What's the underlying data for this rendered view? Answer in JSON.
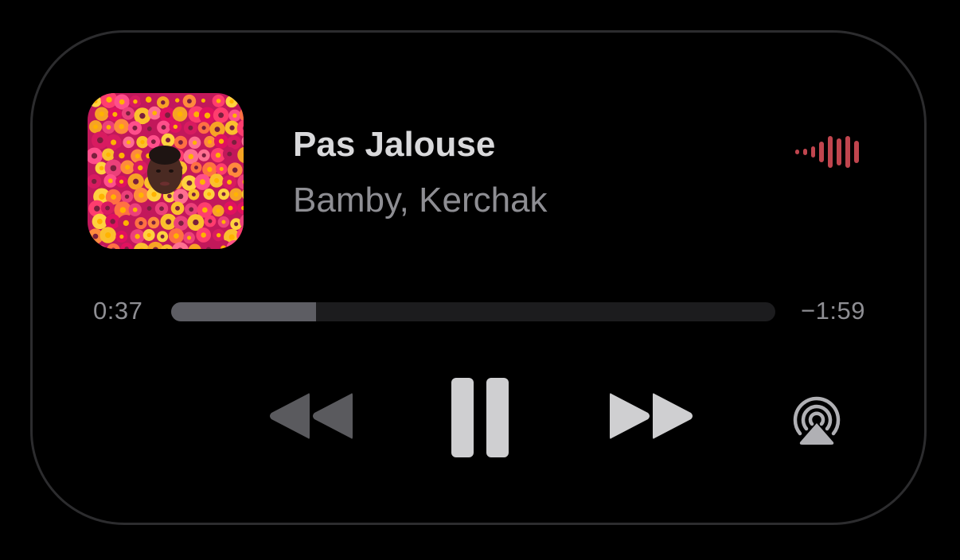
{
  "now_playing": {
    "title": "Pas Jalouse",
    "artist": "Bamby, Kerchak",
    "artwork_icon": "album-art-flowers",
    "waveform_icon": "audio-waveform-icon",
    "accent_color": "#c0454e"
  },
  "progress": {
    "elapsed": "0:37",
    "remaining": "−1:59",
    "fraction": 0.24
  },
  "controls": {
    "rewind_icon": "rewind-icon",
    "pause_icon": "pause-icon",
    "forward_icon": "fast-forward-icon",
    "airplay_icon": "airplay-icon"
  }
}
